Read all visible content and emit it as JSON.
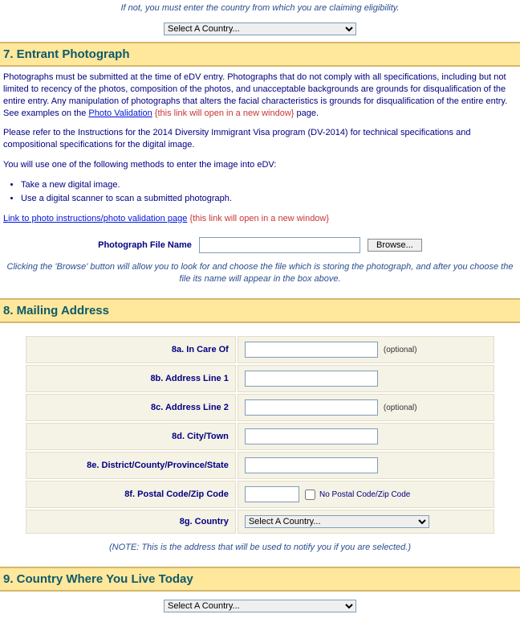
{
  "top_note": "If not, you must enter the country from which you are claiming eligibility.",
  "country_placeholder": "Select A Country...",
  "section7": {
    "title": "7. Entrant Photograph",
    "para1": "Photographs must be submitted at the time of eDV entry. Photographs that do not comply with all specifications, including but not limited to recency of the photos, composition of the photos, and unacceptable backgrounds are grounds for disqualification of the entire entry. Any manipulation of photographs that alters the facial characteristics is grounds for disqualification of the entire entry. See examples on the ",
    "link1_text": "Photo Validation",
    "new_window_text": "{this link will open in a new window}",
    "para1_tail": " page.",
    "para2": "Please refer to the Instructions for the 2014 Diversity Immigrant Visa program (DV-2014) for technical specifications and compositional specifications for the digital image.",
    "para3": "You will use one of the following methods to enter the image into eDV:",
    "bullet1": "Take a new digital image.",
    "bullet2": "Use a digital scanner to scan a submitted photograph.",
    "link2_text": "Link to photo instructions/photo validation page",
    "file_label": "Photograph File Name",
    "browse_label": "Browse...",
    "hint": "Clicking the 'Browse' button will allow you to look for and choose the file which is storing the photograph, and after you choose the file its name will appear in the box above."
  },
  "section8": {
    "title": "8. Mailing Address",
    "rows": {
      "a": "8a. In Care Of",
      "b": "8b. Address Line 1",
      "c": "8c. Address Line 2",
      "d": "8d. City/Town",
      "e": "8e. District/County/Province/State",
      "f": "8f. Postal Code/Zip Code",
      "g": "8g. Country"
    },
    "optional": "(optional)",
    "no_postal": "No Postal Code/Zip Code",
    "note": "(NOTE: This is the address that will be used to notify you if you are selected.)"
  },
  "section9": {
    "title": "9. Country Where You Live Today"
  }
}
